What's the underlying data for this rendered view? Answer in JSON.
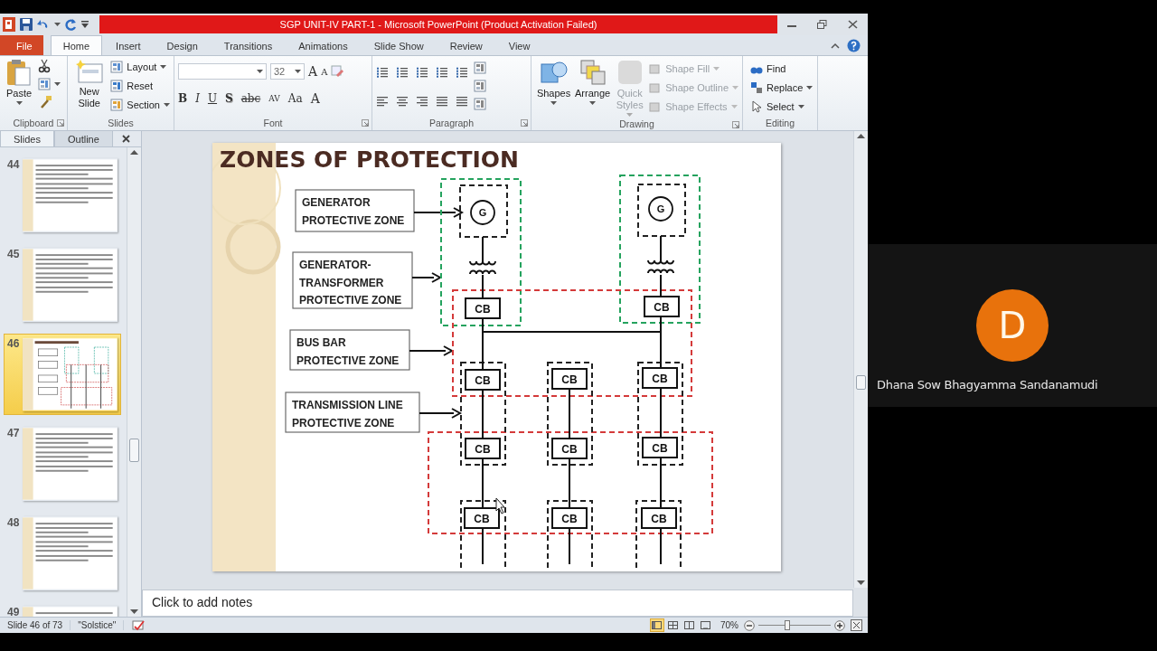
{
  "window": {
    "title": "SGP UNIT-IV PART-1 - Microsoft PowerPoint (Product Activation Failed)"
  },
  "tabs": [
    {
      "label": "File",
      "kind": "file",
      "selected": false
    },
    {
      "label": "Home",
      "kind": "tab",
      "selected": true
    },
    {
      "label": "Insert",
      "kind": "tab",
      "selected": false
    },
    {
      "label": "Design",
      "kind": "tab",
      "selected": false
    },
    {
      "label": "Transitions",
      "kind": "tab",
      "selected": false
    },
    {
      "label": "Animations",
      "kind": "tab",
      "selected": false
    },
    {
      "label": "Slide Show",
      "kind": "tab",
      "selected": false
    },
    {
      "label": "Review",
      "kind": "tab",
      "selected": false
    },
    {
      "label": "View",
      "kind": "tab",
      "selected": false
    }
  ],
  "ribbon": {
    "clipboard": {
      "label": "Clipboard",
      "paste": "Paste"
    },
    "slides": {
      "label": "Slides",
      "new_slide": "New Slide",
      "layout": "Layout",
      "reset": "Reset",
      "section": "Section"
    },
    "font": {
      "label": "Font",
      "size": "32",
      "size_buttons": [
        "A",
        "A"
      ],
      "format_buttons": [
        "B",
        "I",
        "U",
        "S",
        "abc",
        "AV",
        "Aa"
      ],
      "color_button": "A"
    },
    "paragraph": {
      "label": "Paragraph"
    },
    "drawing": {
      "label": "Drawing",
      "buttons": [
        {
          "label": "Shapes",
          "disabled": false
        },
        {
          "label": "Arrange",
          "disabled": false
        },
        {
          "label": "Quick Styles",
          "disabled": true
        }
      ],
      "shape_options": [
        {
          "label": "Shape Fill",
          "disabled": true
        },
        {
          "label": "Shape Outline",
          "disabled": true
        },
        {
          "label": "Shape Effects",
          "disabled": true
        }
      ]
    },
    "editing": {
      "label": "Editing",
      "buttons": [
        "Find",
        "Replace",
        "Select"
      ]
    }
  },
  "slides_panel": {
    "tabs": [
      {
        "label": "Slides",
        "selected": true
      },
      {
        "label": "Outline",
        "selected": false
      }
    ],
    "thumbnails": [
      {
        "number": "44",
        "kind": "text",
        "selected": false
      },
      {
        "number": "45",
        "kind": "text",
        "selected": false
      },
      {
        "number": "46",
        "kind": "diagram",
        "selected": true
      },
      {
        "number": "47",
        "kind": "text",
        "selected": false
      },
      {
        "number": "48",
        "kind": "text",
        "selected": false
      },
      {
        "number": "49",
        "kind": "text",
        "selected": false
      }
    ]
  },
  "slide": {
    "title": "ZONES OF PROTECTION",
    "labels": [
      {
        "lines": [
          "GENERATOR",
          "PROTECTIVE ZONE"
        ]
      },
      {
        "lines": [
          "GENERATOR-",
          "TRANSFORMER",
          "PROTECTIVE ZONE"
        ]
      },
      {
        "lines": [
          "BUS BAR",
          "PROTECTIVE ZONE"
        ]
      },
      {
        "lines": [
          "TRANSMISSION LINE",
          "PROTECTIVE ZONE"
        ]
      }
    ],
    "generators": [
      "G",
      "G"
    ],
    "breakers": [
      "CB",
      "CB",
      "CB",
      "CB",
      "CB",
      "CB",
      "CB",
      "CB",
      "CB",
      "CB",
      "CB"
    ]
  },
  "notes": {
    "placeholder": "Click to add notes"
  },
  "status_bar": {
    "slide_info": "Slide 46 of 73",
    "theme": "\"Solstice\"",
    "views": [
      {
        "selected": true
      },
      {
        "selected": false
      },
      {
        "selected": false
      },
      {
        "selected": false
      }
    ],
    "zoom": "70%",
    "zoom_slider": {
      "level": 0.4
    }
  },
  "participant": {
    "initial": "D",
    "name": "Dhana Sow Bhagyamma Sandanamudi"
  }
}
